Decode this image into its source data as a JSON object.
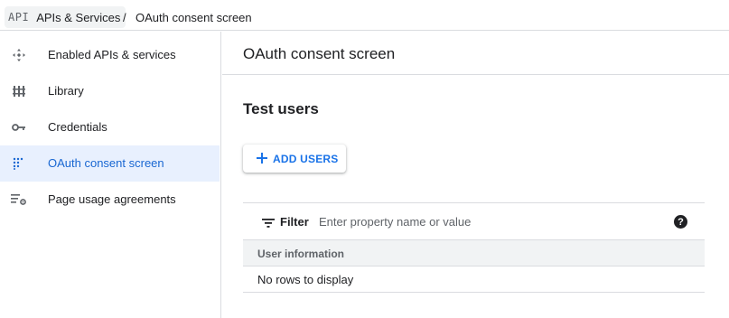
{
  "breadcrumb": {
    "logo": "API",
    "root": "APIs & Services",
    "separator": "/",
    "current": "OAuth consent screen"
  },
  "sidebar": {
    "items": [
      {
        "label": "Enabled APIs & services",
        "icon": "api-move-icon",
        "active": false
      },
      {
        "label": "Library",
        "icon": "library-icon",
        "active": false
      },
      {
        "label": "Credentials",
        "icon": "key-icon",
        "active": false
      },
      {
        "label": "OAuth consent screen",
        "icon": "oauth-dots-icon",
        "active": true
      },
      {
        "label": "Page usage agreements",
        "icon": "settings-list-icon",
        "active": false
      }
    ]
  },
  "main": {
    "title": "OAuth consent screen",
    "section_title": "Test users",
    "add_button": "ADD USERS",
    "filter": {
      "label": "Filter",
      "placeholder": "Enter property name or value",
      "help": "?"
    },
    "table": {
      "columns": [
        "User information"
      ],
      "empty_message": "No rows to display"
    }
  },
  "colors": {
    "accent": "#1a73e8",
    "active_bg": "#e8f0fe",
    "active_text": "#1967d2",
    "border": "#dadce0"
  }
}
